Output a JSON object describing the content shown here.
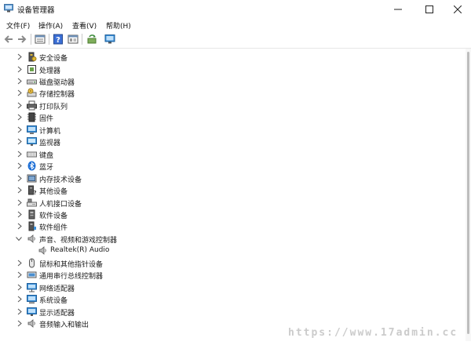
{
  "window": {
    "title": "设备管理器",
    "minimize_icon": "minimize-icon",
    "maximize_icon": "maximize-icon",
    "close_icon": "close-icon"
  },
  "menubar": {
    "items": [
      {
        "label": "文件(F)"
      },
      {
        "label": "操作(A)"
      },
      {
        "label": "查看(V)"
      },
      {
        "label": "帮助(H)"
      }
    ]
  },
  "toolbar": {
    "buttons": [
      {
        "icon": "back-arrow-icon"
      },
      {
        "icon": "forward-arrow-icon"
      },
      {
        "icon": "properties-window-icon"
      },
      {
        "icon": "help-icon"
      },
      {
        "icon": "list-view-icon"
      },
      {
        "icon": "update-driver-icon"
      },
      {
        "icon": "monitor-scan-icon"
      }
    ]
  },
  "tree": {
    "items": [
      {
        "label": "安全设备",
        "icon": "security-device-icon",
        "expanded": false
      },
      {
        "label": "处理器",
        "icon": "processor-icon",
        "expanded": false
      },
      {
        "label": "磁盘驱动器",
        "icon": "disk-drive-icon",
        "expanded": false
      },
      {
        "label": "存储控制器",
        "icon": "storage-controller-icon",
        "expanded": false
      },
      {
        "label": "打印队列",
        "icon": "printer-icon",
        "expanded": false
      },
      {
        "label": "固件",
        "icon": "firmware-icon",
        "expanded": false
      },
      {
        "label": "计算机",
        "icon": "computer-icon",
        "expanded": false
      },
      {
        "label": "监视器",
        "icon": "monitor-icon",
        "expanded": false
      },
      {
        "label": "键盘",
        "icon": "keyboard-icon",
        "expanded": false
      },
      {
        "label": "蓝牙",
        "icon": "bluetooth-icon",
        "expanded": false
      },
      {
        "label": "内存技术设备",
        "icon": "memory-device-icon",
        "expanded": false
      },
      {
        "label": "其他设备",
        "icon": "other-device-icon",
        "expanded": false
      },
      {
        "label": "人机接口设备",
        "icon": "hid-icon",
        "expanded": false
      },
      {
        "label": "软件设备",
        "icon": "software-device-icon",
        "expanded": false
      },
      {
        "label": "软件组件",
        "icon": "software-component-icon",
        "expanded": false
      },
      {
        "label": "声音、视频和游戏控制器",
        "icon": "speaker-icon",
        "expanded": true
      },
      {
        "label": "Realtek(R) Audio",
        "icon": "speaker-icon",
        "child": true
      },
      {
        "label": "鼠标和其他指针设备",
        "icon": "mouse-icon",
        "expanded": false
      },
      {
        "label": "通用串行总线控制器",
        "icon": "usb-controller-icon",
        "expanded": false
      },
      {
        "label": "网络适配器",
        "icon": "network-adapter-icon",
        "expanded": false
      },
      {
        "label": "系统设备",
        "icon": "system-device-icon",
        "expanded": false
      },
      {
        "label": "显示适配器",
        "icon": "display-adapter-icon",
        "expanded": false
      },
      {
        "label": "音频输入和输出",
        "icon": "audio-io-icon",
        "expanded": false
      }
    ]
  },
  "watermark": {
    "text": "https://www.17admin.cc"
  },
  "colors": {
    "accent": "#2f7fd8",
    "chevron": "#555555",
    "separator": "#c8c8c8"
  }
}
